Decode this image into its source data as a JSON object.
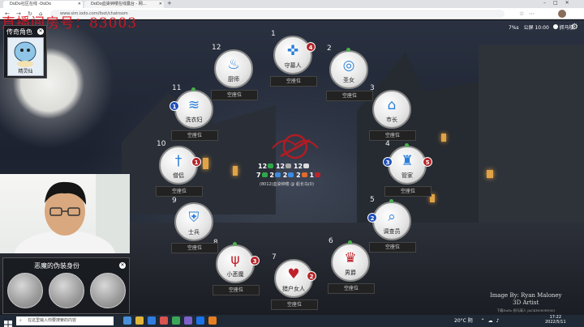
{
  "browser": {
    "tabs": [
      {
        "label": "DoDo社区在线 -DoDo"
      },
      {
        "label": "DoDo血染钟楼在线露台 - 网..."
      }
    ],
    "url": "www.sim.iodo.com/foot/chatroom"
  },
  "watermark": "直播间房号：83003",
  "role_panel": {
    "title": "传奇角色",
    "card_caption": "精灵仙"
  },
  "demon_panel": {
    "title": "恶魔的伪装身份"
  },
  "center": {
    "row1": [
      "12",
      "12",
      "12"
    ],
    "row2": [
      "7",
      "2",
      "2",
      "2",
      "1"
    ],
    "id_line": "(8012)血染钟楼",
    "host": "@ 船长乌(0)"
  },
  "top_right": {
    "ping": "7%s",
    "label": "公屏 10:00",
    "user": "抓马楼"
  },
  "credit": {
    "line1": "Image By: Ryan Maloney",
    "line2": "3D Artist",
    "line3": "下载DoDo  抓马高人  JACKN000W(00)"
  },
  "seats": [
    {
      "num": "1",
      "role": "守墓人",
      "button": "空座位",
      "glyph": "✜",
      "color": "#2a7fd8",
      "token": "4",
      "token_color": "#b3262b"
    },
    {
      "num": "2",
      "role": "圣女",
      "button": "空座位",
      "glyph": "◎",
      "color": "#2a7fd8"
    },
    {
      "num": "3",
      "role": "市长",
      "button": "空座位",
      "glyph": "⌂",
      "color": "#2a7fd8"
    },
    {
      "num": "4",
      "role": "管家",
      "button": "空座位",
      "glyph": "♜",
      "color": "#2a7fd8",
      "token": "3",
      "token_color": "#1f4fb8",
      "token2": "5",
      "token2_color": "#b3262b"
    },
    {
      "num": "5",
      "role": "调查员",
      "button": "空座位",
      "glyph": "⌕",
      "color": "#2a7fd8",
      "token": "2",
      "token_color": "#1f4fb8"
    },
    {
      "num": "6",
      "role": "男爵",
      "button": "空座位",
      "glyph": "♛",
      "color": "#c0222b"
    },
    {
      "num": "7",
      "role": "猎户女人",
      "button": "空座位",
      "glyph": "♥",
      "color": "#c0222b",
      "token": "2",
      "token_color": "#b3262b"
    },
    {
      "num": "8",
      "role": "小恶魔",
      "button": "空座位",
      "glyph": "ψ",
      "color": "#c0222b",
      "token": "3",
      "token_color": "#b3262b"
    },
    {
      "num": "9",
      "role": "士兵",
      "button": "空座位",
      "glyph": "⛨",
      "color": "#2a7fd8"
    },
    {
      "num": "10",
      "role": "僧侣",
      "button": "空座位",
      "glyph": "†",
      "color": "#2a7fd8",
      "token": "1",
      "token_color": "#b3262b"
    },
    {
      "num": "11",
      "role": "洗衣妇",
      "button": "空座位",
      "glyph": "≋",
      "color": "#2a7fd8",
      "token": "1",
      "token_color": "#1f4fb8"
    },
    {
      "num": "12",
      "role": "厨师",
      "button": "空座位",
      "glyph": "♨",
      "color": "#2a7fd8"
    }
  ],
  "taskbar": {
    "search": "在这里输入你要搜索的内容",
    "weather": "20°C 阴",
    "time": "17:22",
    "date": "2022/5/11"
  },
  "icons": {
    "close": "close-icon",
    "gear": "gear-icon",
    "search": "search-icon",
    "windows": "windows-icon"
  }
}
